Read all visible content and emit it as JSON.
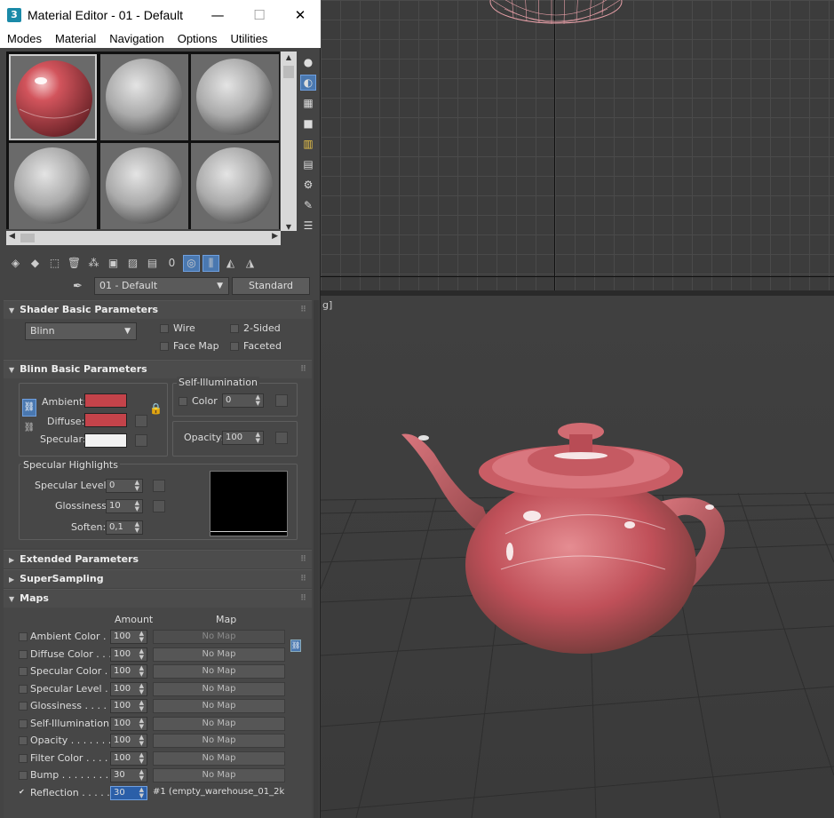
{
  "window": {
    "app_icon": "3",
    "title": "Material Editor - 01 - Default",
    "minimize": "—",
    "maximize": "☐",
    "close": "✕"
  },
  "menu": [
    "Modes",
    "Material",
    "Navigation",
    "Options",
    "Utilities"
  ],
  "toolbar": {
    "material_name": "01 - Default",
    "material_type": "Standard"
  },
  "shader_basic": {
    "title": "Shader Basic Parameters",
    "shader": "Blinn",
    "wire": "Wire",
    "two_sided": "2-Sided",
    "face_map": "Face Map",
    "faceted": "Faceted"
  },
  "blinn_basic": {
    "title": "Blinn Basic Parameters",
    "ambient": "Ambient:",
    "diffuse": "Diffuse:",
    "specular": "Specular:",
    "ambient_color": "#c4434a",
    "diffuse_color": "#c4434a",
    "specular_color": "#f2f2f2",
    "self_illum_title": "Self-Illumination",
    "self_illum_color": "Color",
    "self_illum_value": "0",
    "opacity_label": "Opacity:",
    "opacity_value": "100",
    "spec_highlights_title": "Specular Highlights",
    "spec_level_label": "Specular Level:",
    "spec_level_value": "0",
    "glossiness_label": "Glossiness:",
    "glossiness_value": "10",
    "soften_label": "Soften:",
    "soften_value": "0,1"
  },
  "rollouts": {
    "extended": "Extended Parameters",
    "supersampling": "SuperSampling",
    "maps": "Maps"
  },
  "maps": {
    "amount_header": "Amount",
    "map_header": "Map",
    "rows": [
      {
        "label": "Ambient Color . . .",
        "amount": "100",
        "map": "No Map",
        "checked": false
      },
      {
        "label": "Diffuse Color . . . .",
        "amount": "100",
        "map": "No Map",
        "checked": false
      },
      {
        "label": "Specular Color  . .",
        "amount": "100",
        "map": "No Map",
        "checked": false
      },
      {
        "label": "Specular Level  . .",
        "amount": "100",
        "map": "No Map",
        "checked": false
      },
      {
        "label": "Glossiness  . . . . .",
        "amount": "100",
        "map": "No Map",
        "checked": false
      },
      {
        "label": "Self-Illumination . .",
        "amount": "100",
        "map": "No Map",
        "checked": false
      },
      {
        "label": "Opacity . . . . . . .",
        "amount": "100",
        "map": "No Map",
        "checked": false
      },
      {
        "label": "Filter Color  . . . .",
        "amount": "100",
        "map": "No Map",
        "checked": false
      },
      {
        "label": "Bump  . . . . . . . .",
        "amount": "30",
        "map": "No Map",
        "checked": false
      },
      {
        "label": "Reflection  . . . . .",
        "amount": "30",
        "map": "#1 (empty_warehouse_01_2k.",
        "checked": true
      }
    ]
  },
  "viewport": {
    "persp_label": "g]"
  }
}
